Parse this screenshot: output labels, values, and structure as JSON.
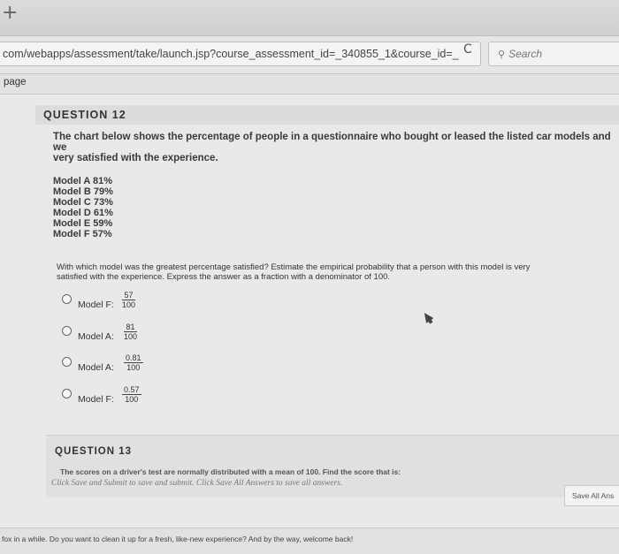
{
  "browser": {
    "new_tab_icon": "+",
    "url": "com/webapps/assessment/take/launch.jsp?course_assessment_id=_340855_1&course_id=_",
    "reload_icon": "C",
    "search_placeholder": "Search",
    "bookmark_label": "page"
  },
  "question12": {
    "title": "QUESTION 12",
    "prompt_line1": "The chart below shows the percentage of people in a questionnaire who bought or leased the listed car models and we",
    "prompt_line2": "very satisfied with the experience.",
    "models": [
      "Model A 81%",
      "Model B 79%",
      "Model C 73%",
      "Model D 61%",
      "Model E 59%",
      "Model F 57%"
    ],
    "question_line1": "With which model was the greatest percentage satisfied? Estimate the empirical probability that a person with this model is very",
    "question_line2": "satisfied with the experience. Express the answer as a fraction with a denominator of 100.",
    "options": [
      {
        "label": "Model F:",
        "numerator": "57",
        "denominator": "100"
      },
      {
        "label": "Model A:",
        "numerator": "81",
        "denominator": "100"
      },
      {
        "label": "Model A:",
        "numerator": "0.81",
        "denominator": "100"
      },
      {
        "label": "Model F:",
        "numerator": "0.57",
        "denominator": "100"
      }
    ]
  },
  "question13": {
    "title": "QUESTION 13",
    "text": "The scores on a driver's test are normally distributed with a mean of 100. Find the score that is:"
  },
  "hint": "Click Save and Submit to save and submit. Click Save All Answers to save all answers.",
  "save_all_label": "Save All Ans",
  "footer_text": "fox in a while. Do you want to clean it up for a fresh, like-new experience? And by the way, welcome back!"
}
